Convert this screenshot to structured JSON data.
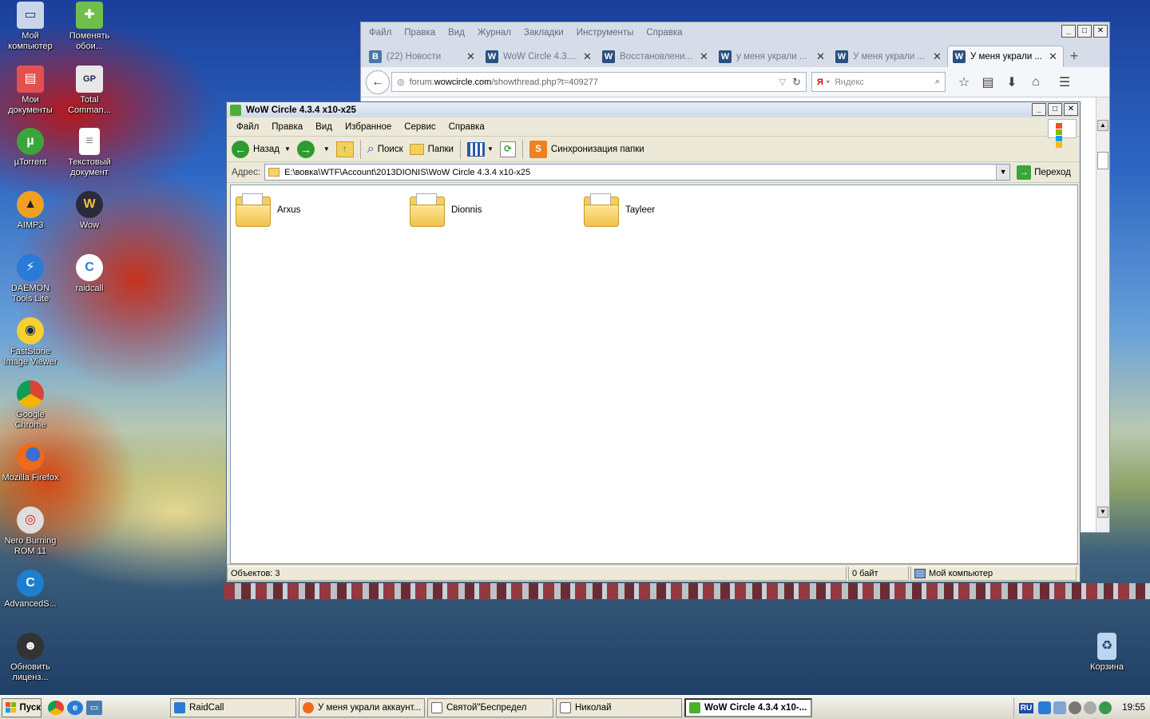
{
  "desktop": {
    "icons": [
      {
        "label": "Мой компьютер",
        "icon": "my-computer-icon",
        "x": 0,
        "y": 0
      },
      {
        "label": "Поменять обои...",
        "icon": "change-wallpaper-icon"
      },
      {
        "label": "Мои документы",
        "icon": "my-documents-icon"
      },
      {
        "label": "Total Comman...",
        "icon": "total-commander-icon"
      },
      {
        "label": "µTorrent",
        "icon": "utorrent-icon"
      },
      {
        "label": "Текстовый документ",
        "icon": "text-document-icon"
      },
      {
        "label": "AIMP3",
        "icon": "aimp-icon"
      },
      {
        "label": "Wow",
        "icon": "wow-icon"
      },
      {
        "label": "DAEMON Tools Lite",
        "icon": "daemon-tools-icon"
      },
      {
        "label": "raidcall",
        "icon": "raidcall-icon"
      },
      {
        "label": "FastStone Image Viewer",
        "icon": "faststone-icon"
      },
      {
        "label": "Google Chrome",
        "icon": "chrome-icon"
      },
      {
        "label": "Mozilla Firefox",
        "icon": "firefox-icon"
      },
      {
        "label": "Nero Burning ROM 11",
        "icon": "nero-icon"
      },
      {
        "label": "AdvancedS...",
        "icon": "advanced-systemcare-icon"
      },
      {
        "label": "Обновить лиценз...",
        "icon": "update-license-icon"
      },
      {
        "label": "Корзина",
        "icon": "recycle-bin-icon"
      }
    ]
  },
  "firefox": {
    "menu": [
      "Файл",
      "Правка",
      "Вид",
      "Журнал",
      "Закладки",
      "Инструменты",
      "Справка"
    ],
    "tabs": [
      {
        "label": "(22) Новости",
        "favicon": "B"
      },
      {
        "label": "WoW Circle 4.3....",
        "favicon": "W"
      },
      {
        "label": "Восстановлени...",
        "favicon": "W"
      },
      {
        "label": "у меня украли ...",
        "favicon": "W"
      },
      {
        "label": "У меня украли ...",
        "favicon": "W"
      },
      {
        "label": "У меня украли ...",
        "favicon": "W"
      }
    ],
    "url_prefix": "forum.",
    "url_host": "wowcircle.com",
    "url_path": "/showthread.php?t=409277",
    "search_placeholder": "Яндекс",
    "search_engine_badge": "Я"
  },
  "explorer": {
    "title": "WoW Circle 4.3.4 x10-x25",
    "menu": [
      "Файл",
      "Правка",
      "Вид",
      "Избранное",
      "Сервис",
      "Справка"
    ],
    "toolbar": {
      "back": "Назад",
      "search": "Поиск",
      "folders": "Папки",
      "sync": "Синхронизация папки"
    },
    "address_label": "Адрес:",
    "address_value": "E:\\вовка\\WTF\\Account\\2013DIONIS\\WoW Circle 4.3.4 x10-x25",
    "go_label": "Переход",
    "folders": [
      "Arxus",
      "Dionnis",
      "Tayleer"
    ],
    "status": {
      "objects": "Объектов: 3",
      "size": "0 байт",
      "location": "Мой компьютер"
    }
  },
  "taskbar": {
    "start_label": "Пуск",
    "tasks": [
      {
        "label": "RaidCall",
        "active": false
      },
      {
        "label": "У меня украли аккаунт...",
        "active": false
      },
      {
        "label": "Святой\"Беспредел",
        "active": false
      },
      {
        "label": "Николай",
        "active": false
      },
      {
        "label": "WoW Circle 4.3.4 x10-...",
        "active": true
      }
    ],
    "language": "RU",
    "clock": "19:55"
  }
}
